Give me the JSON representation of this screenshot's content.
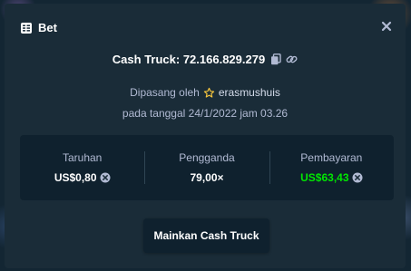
{
  "modal": {
    "title": "Bet",
    "title_icon": "receipt-icon",
    "close_icon": "close-icon"
  },
  "game": {
    "label": "Cash Truck: 72.166.829.279",
    "copy_icon": "copy-icon",
    "link_icon": "link-icon"
  },
  "placed": {
    "prefix": "Dipasang oleh",
    "user_icon": "star-icon",
    "username": "erasmushuis",
    "date_text": "pada tanggal 24/1/2022 jam 03.26"
  },
  "stats": {
    "wager_label": "Taruhan",
    "wager_value": "US$0,80",
    "multiplier_label": "Pengganda",
    "multiplier_value": "79,00×",
    "payout_label": "Pembayaran",
    "payout_value": "US$63,43",
    "currency_icon": "coin-icon"
  },
  "actions": {
    "play_label": "Mainkan Cash Truck"
  },
  "colors": {
    "accent_green": "#00e701",
    "star_yellow": "#f2c33d",
    "modal_bg": "#1a2c38",
    "panel_bg": "#0f212e"
  }
}
